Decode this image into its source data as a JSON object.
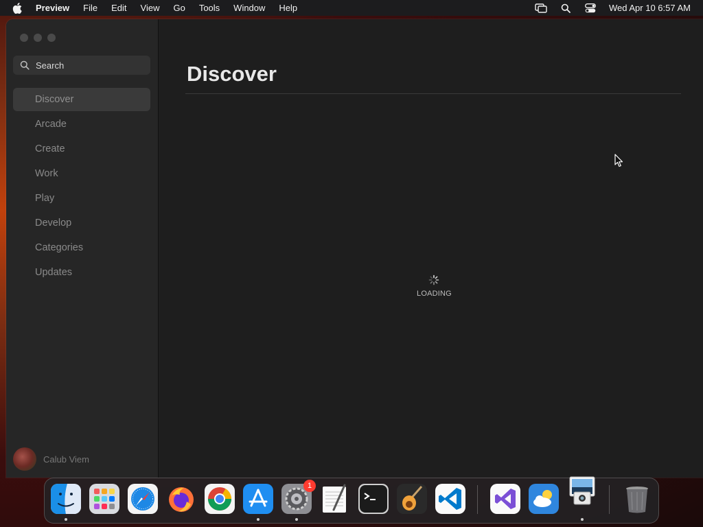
{
  "menubar": {
    "app_name": "Preview",
    "items": [
      "File",
      "Edit",
      "View",
      "Go",
      "Tools",
      "Window",
      "Help"
    ],
    "clock": "Wed Apr 10  6:57 AM"
  },
  "sidebar": {
    "search_placeholder": "Search",
    "items": [
      {
        "label": "Discover"
      },
      {
        "label": "Arcade"
      },
      {
        "label": "Create"
      },
      {
        "label": "Work"
      },
      {
        "label": "Play"
      },
      {
        "label": "Develop"
      },
      {
        "label": "Categories"
      },
      {
        "label": "Updates"
      }
    ],
    "active_index": 0,
    "user_name": "Calub Viem"
  },
  "main": {
    "title": "Discover",
    "loading_label": "LOADING"
  },
  "dock": {
    "apps": [
      {
        "name": "Finder",
        "icon": "finder-icon",
        "running": true
      },
      {
        "name": "Launchpad",
        "icon": "launchpad-icon",
        "running": false
      },
      {
        "name": "Safari",
        "icon": "safari-icon",
        "running": false
      },
      {
        "name": "Firefox",
        "icon": "firefox-icon",
        "running": false
      },
      {
        "name": "Chrome",
        "icon": "chrome-icon",
        "running": false
      },
      {
        "name": "App Store",
        "icon": "app-store-icon",
        "running": true
      },
      {
        "name": "System Settings",
        "icon": "system-settings-icon",
        "running": true,
        "badge": "1"
      },
      {
        "name": "TextEdit",
        "icon": "textedit-icon",
        "running": false
      },
      {
        "name": "Terminal",
        "icon": "terminal-icon",
        "running": false
      },
      {
        "name": "GarageBand",
        "icon": "garageband-icon",
        "running": false
      },
      {
        "name": "VS Code",
        "icon": "vscode-icon",
        "running": false
      },
      {
        "name": "Visual Studio",
        "icon": "visual-studio-icon",
        "running": false
      },
      {
        "name": "Weather",
        "icon": "weather-icon",
        "running": false
      },
      {
        "name": "Preview",
        "icon": "preview-icon",
        "running": true
      },
      {
        "name": "Trash",
        "icon": "trash-icon",
        "running": false
      }
    ]
  },
  "colors": {
    "accent_badge": "#ff3b30",
    "window_bg": "#1e1e1e",
    "sidebar_bg": "#262626"
  }
}
